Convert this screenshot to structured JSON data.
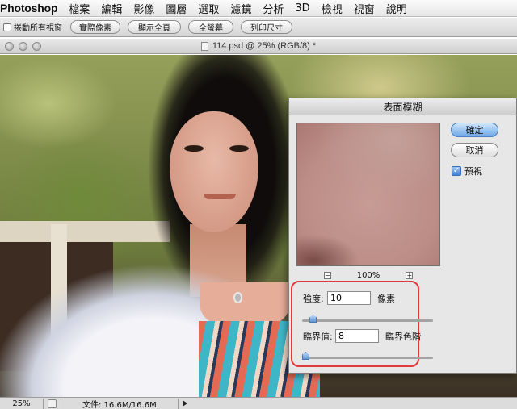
{
  "menubar": {
    "app_name": "Photoshop",
    "items": [
      "檔案",
      "編輯",
      "影像",
      "圖層",
      "選取",
      "濾鏡",
      "分析",
      "3D",
      "檢視",
      "視窗",
      "說明"
    ]
  },
  "options_bar": {
    "scroll_all_windows": {
      "label": "捲動所有視窗",
      "checked": false
    },
    "buttons": [
      "實際像素",
      "顯示全頁",
      "全螢幕",
      "列印尺寸"
    ]
  },
  "document": {
    "title": "114.psd @ 25% (RGB/8) *"
  },
  "dialog": {
    "title": "表面模糊",
    "ok_label": "確定",
    "cancel_label": "取消",
    "preview": {
      "label": "預視",
      "checked": true
    },
    "zoom_level": "100%",
    "zoom_out_symbol": "−",
    "zoom_in_symbol": "+",
    "radius": {
      "label": "強度:",
      "value": "10",
      "unit": "像素",
      "slider_fraction": 0.06
    },
    "threshold": {
      "label": "臨界值:",
      "value": "8",
      "unit": "臨界色階",
      "slider_fraction": 0.0
    }
  },
  "status_bar": {
    "zoom": "25%",
    "doc_info": "文件: 16.6M/16.6M"
  },
  "colors": {
    "highlight": "#e23a3a",
    "default_button": "#6fa8e6"
  }
}
